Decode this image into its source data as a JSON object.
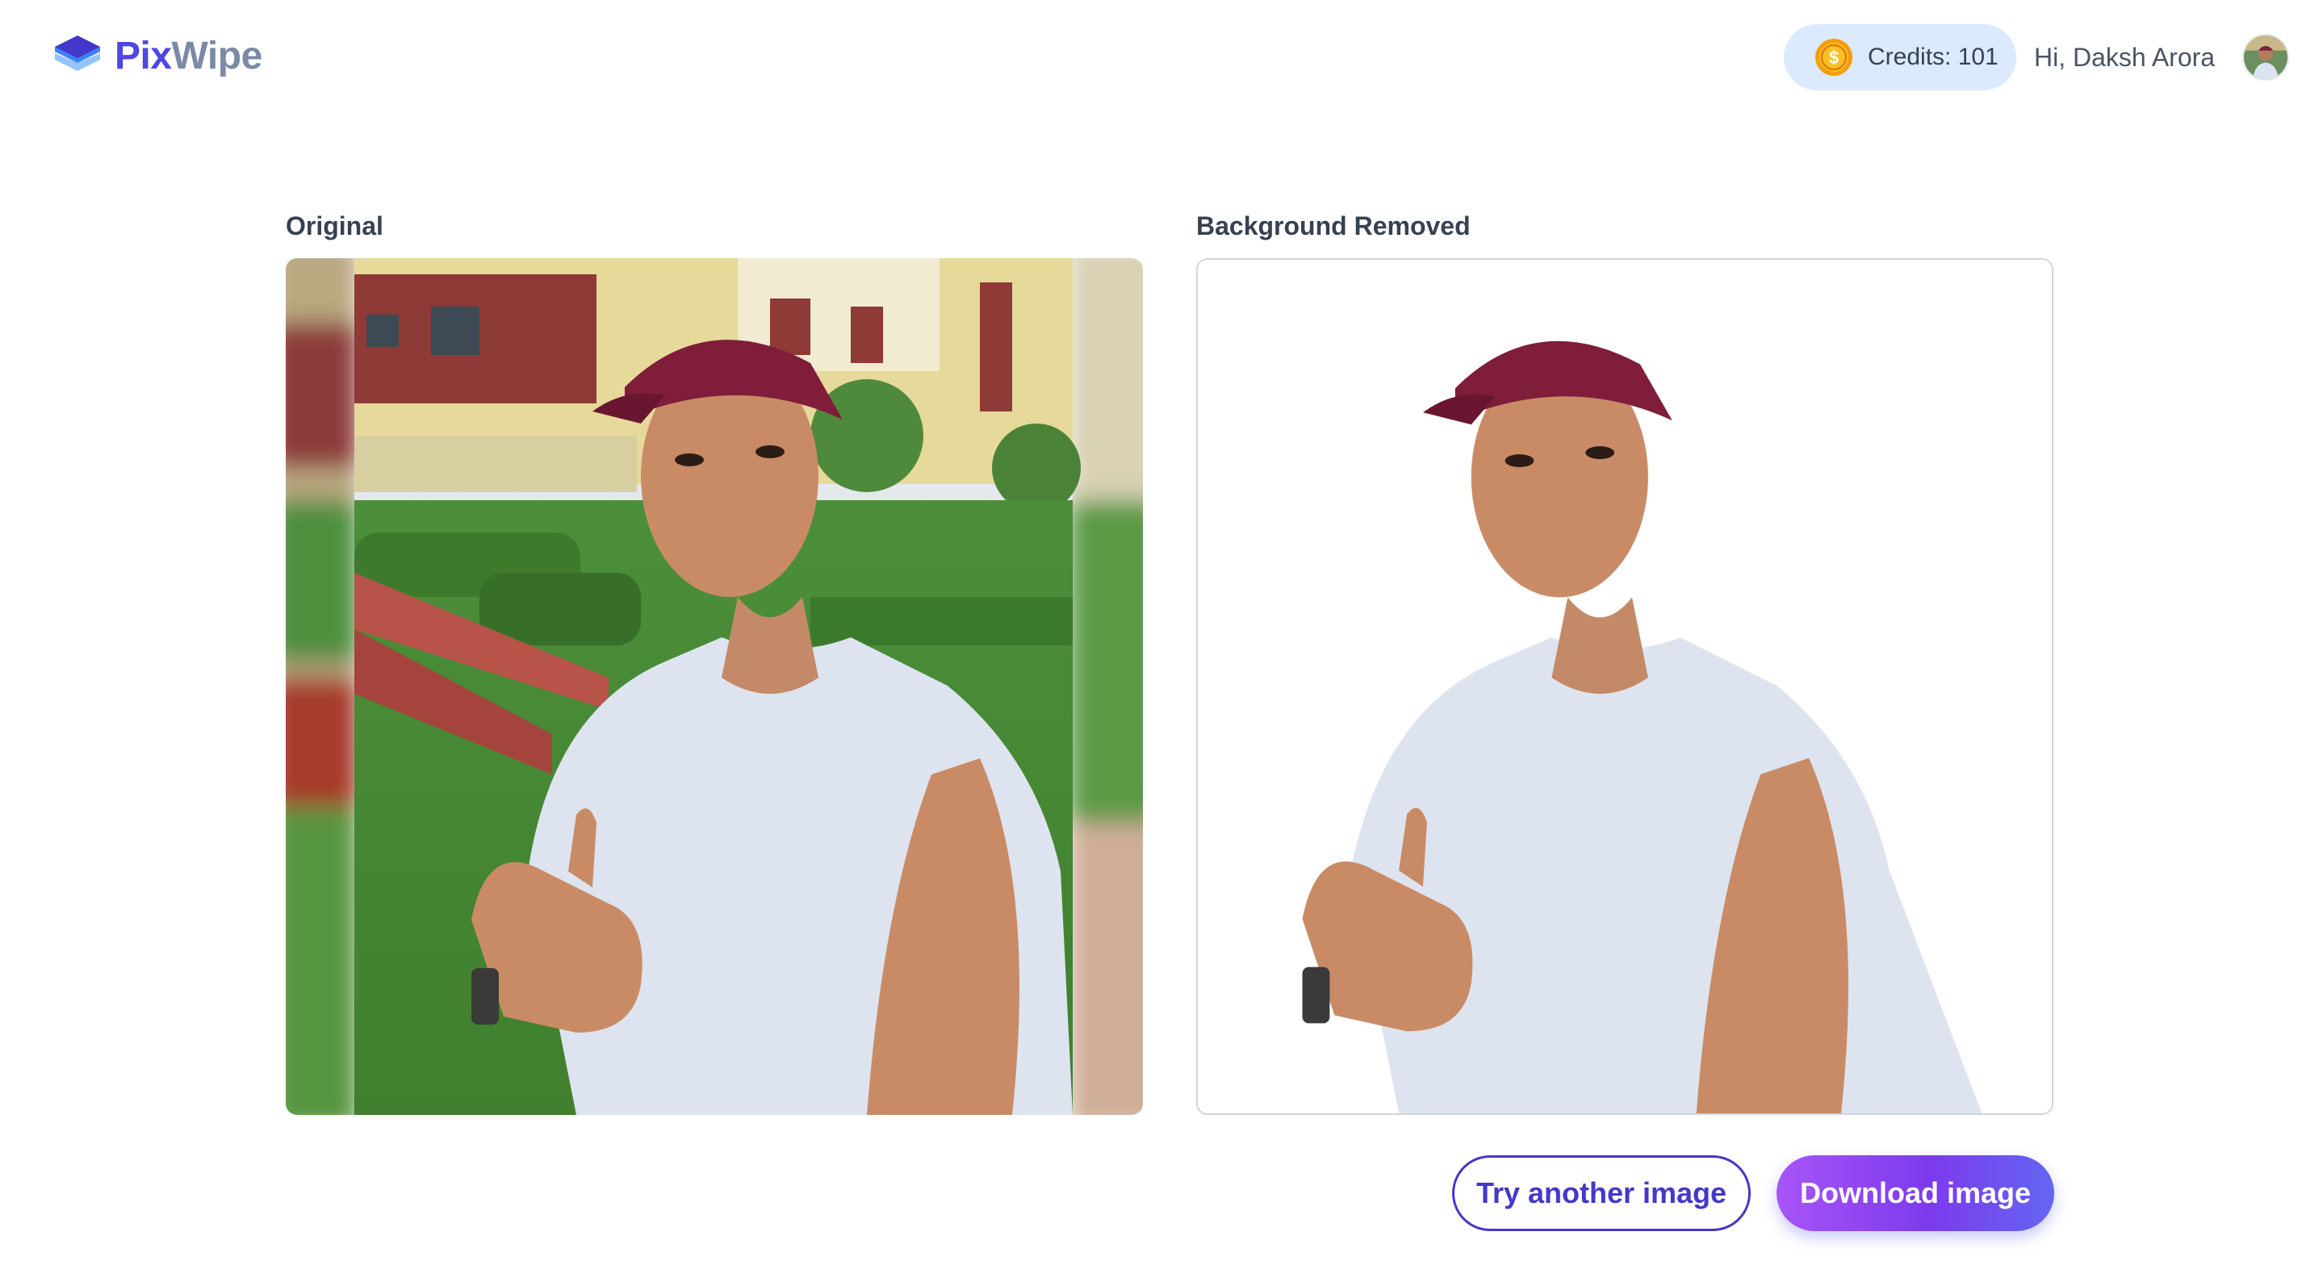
{
  "app": {
    "name_part1": "Pix",
    "name_part2": "Wipe",
    "logo_icon": "layers-icon",
    "brand_color": "#4f46e5"
  },
  "header": {
    "credits_label": "Credits: 101",
    "coin_icon": "coin-dollar-icon",
    "greeting": "Hi, Daksh Arora",
    "avatar_icon": "user-avatar"
  },
  "panels": {
    "original_title": "Original",
    "removed_title": "Background Removed"
  },
  "actions": {
    "try_another_label": "Try another image",
    "download_label": "Download image",
    "primary_gradient": [
      "#a855f7",
      "#6366f1"
    ]
  }
}
